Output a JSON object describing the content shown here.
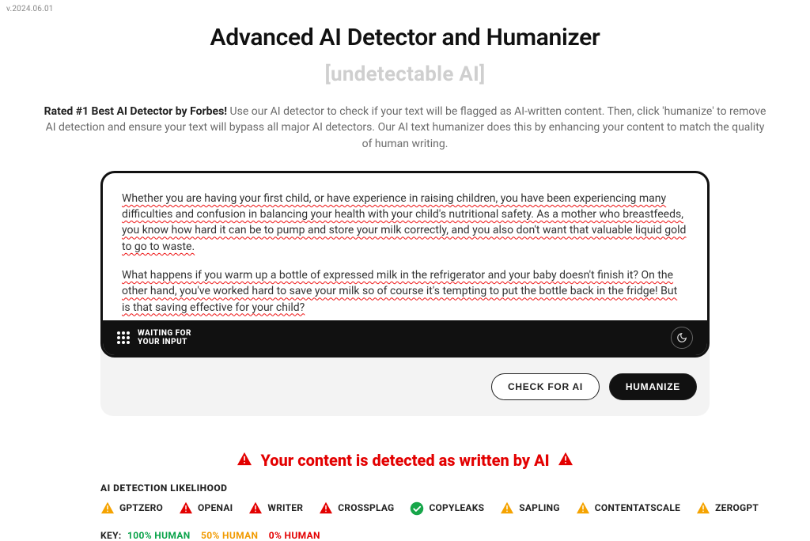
{
  "version": "v.2024.06.01",
  "title": "Advanced AI Detector and Humanizer",
  "subtitle_left_bracket": "[",
  "subtitle_text": "undetectable AI",
  "subtitle_right_bracket": "]",
  "intro_strong": "Rated #1 Best AI Detector by Forbes!",
  "intro_rest": " Use our AI detector to check if your text will be flagged as AI-written content. Then, click 'humanize' to remove AI detection and ensure your text will bypass all major AI detectors. Our AI text humanizer does this by enhancing your content to match the quality of human writing.",
  "editor": {
    "paragraph1": "Whether you are having your first child, or have experience in raising children, you have been experiencing many difficulties and confusion in balancing your health with your child's nutritional safety. As a mother who breastfeeds, you know how hard it can be to pump and store your milk correctly, and you also don't want that valuable liquid gold to go to waste.",
    "paragraph2": "What happens if you warm up a bottle of expressed milk in the refrigerator and your baby doesn't finish it? On the other hand, you've worked hard to save your milk so of course it's tempting to put the bottle back in the fridge! But is that saving effective for your child?",
    "waiting_line1": "WAITING FOR",
    "waiting_line2": "YOUR INPUT"
  },
  "actions": {
    "check": "CHECK FOR AI",
    "humanize": "HUMANIZE"
  },
  "result_banner": "Your content is detected as written by AI",
  "detectors": {
    "heading": "AI DETECTION LIKELIHOOD",
    "items": [
      {
        "name": "GPTZERO",
        "status": "warn"
      },
      {
        "name": "OPENAI",
        "status": "bad"
      },
      {
        "name": "WRITER",
        "status": "bad"
      },
      {
        "name": "CROSSPLAG",
        "status": "bad"
      },
      {
        "name": "COPYLEAKS",
        "status": "ok"
      },
      {
        "name": "SAPLING",
        "status": "warn"
      },
      {
        "name": "CONTENTATSCALE",
        "status": "warn"
      },
      {
        "name": "ZEROGPT",
        "status": "warn"
      }
    ]
  },
  "legend": {
    "key": "KEY:",
    "human100": "100% HUMAN",
    "human50": "50% HUMAN",
    "human0": "0% HUMAN"
  },
  "colors": {
    "warn": "#f5a300",
    "bad": "#e30000",
    "ok": "#17a64a"
  }
}
